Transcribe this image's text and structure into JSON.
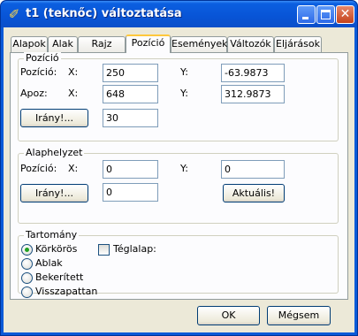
{
  "window": {
    "title": "t1 (teknőc) változtatása"
  },
  "tabs": [
    "Alapok",
    "Alak",
    "Rajz",
    "Pozíció",
    "Események",
    "Változók",
    "Eljárások"
  ],
  "active_tab": "Pozíció",
  "position": {
    "group_label": "Pozíció",
    "row1_label": "Pozíció:",
    "row2_label": "Apoz:",
    "x_label": "X:",
    "y_label": "Y:",
    "pos_x": "250",
    "pos_y": "-63.9873",
    "apoz_x": "648",
    "apoz_y": "312.9873",
    "direction_button": "Irány!...",
    "direction_value": "30"
  },
  "initial": {
    "group_label": "Alaphelyzet",
    "row_label": "Pozíció:",
    "x_label": "X:",
    "y_label": "Y:",
    "pos_x": "0",
    "pos_y": "0",
    "direction_button": "Irány!...",
    "direction_value": "0",
    "current_button": "Aktuális!"
  },
  "domain": {
    "group_label": "Tartomány",
    "options": [
      "Körkörös",
      "Ablak",
      "Bekerített",
      "Visszapattan"
    ],
    "selected_index": 0,
    "rect_label": "Téglalap:",
    "rect_checked": false
  },
  "footer": {
    "ok": "OK",
    "cancel": "Mégsem"
  }
}
